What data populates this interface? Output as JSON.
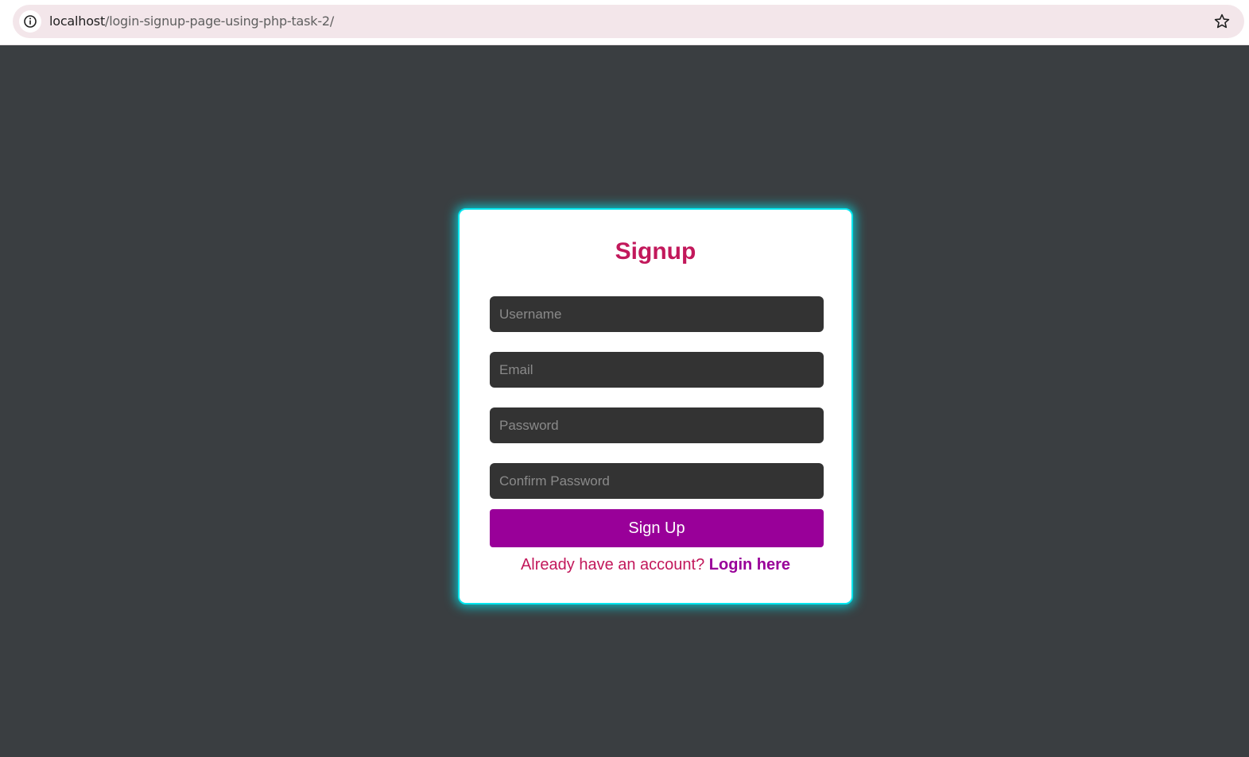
{
  "browser": {
    "url_host": "localhost",
    "url_path": "/login-signup-page-using-php-task-2/"
  },
  "signup_form": {
    "title": "Signup",
    "username_placeholder": "Username",
    "email_placeholder": "Email",
    "password_placeholder": "Password",
    "confirm_password_placeholder": "Confirm Password",
    "submit_label": "Sign Up",
    "login_prompt": "Already have an account?",
    "login_link": "Login here"
  },
  "colors": {
    "page_background": "#3a3e41",
    "card_glow": "#00e5ee",
    "title": "#c2185b",
    "button": "#990099",
    "input_background": "#333333"
  },
  "icons": {
    "site_info": "info-icon",
    "bookmark": "star-icon"
  }
}
